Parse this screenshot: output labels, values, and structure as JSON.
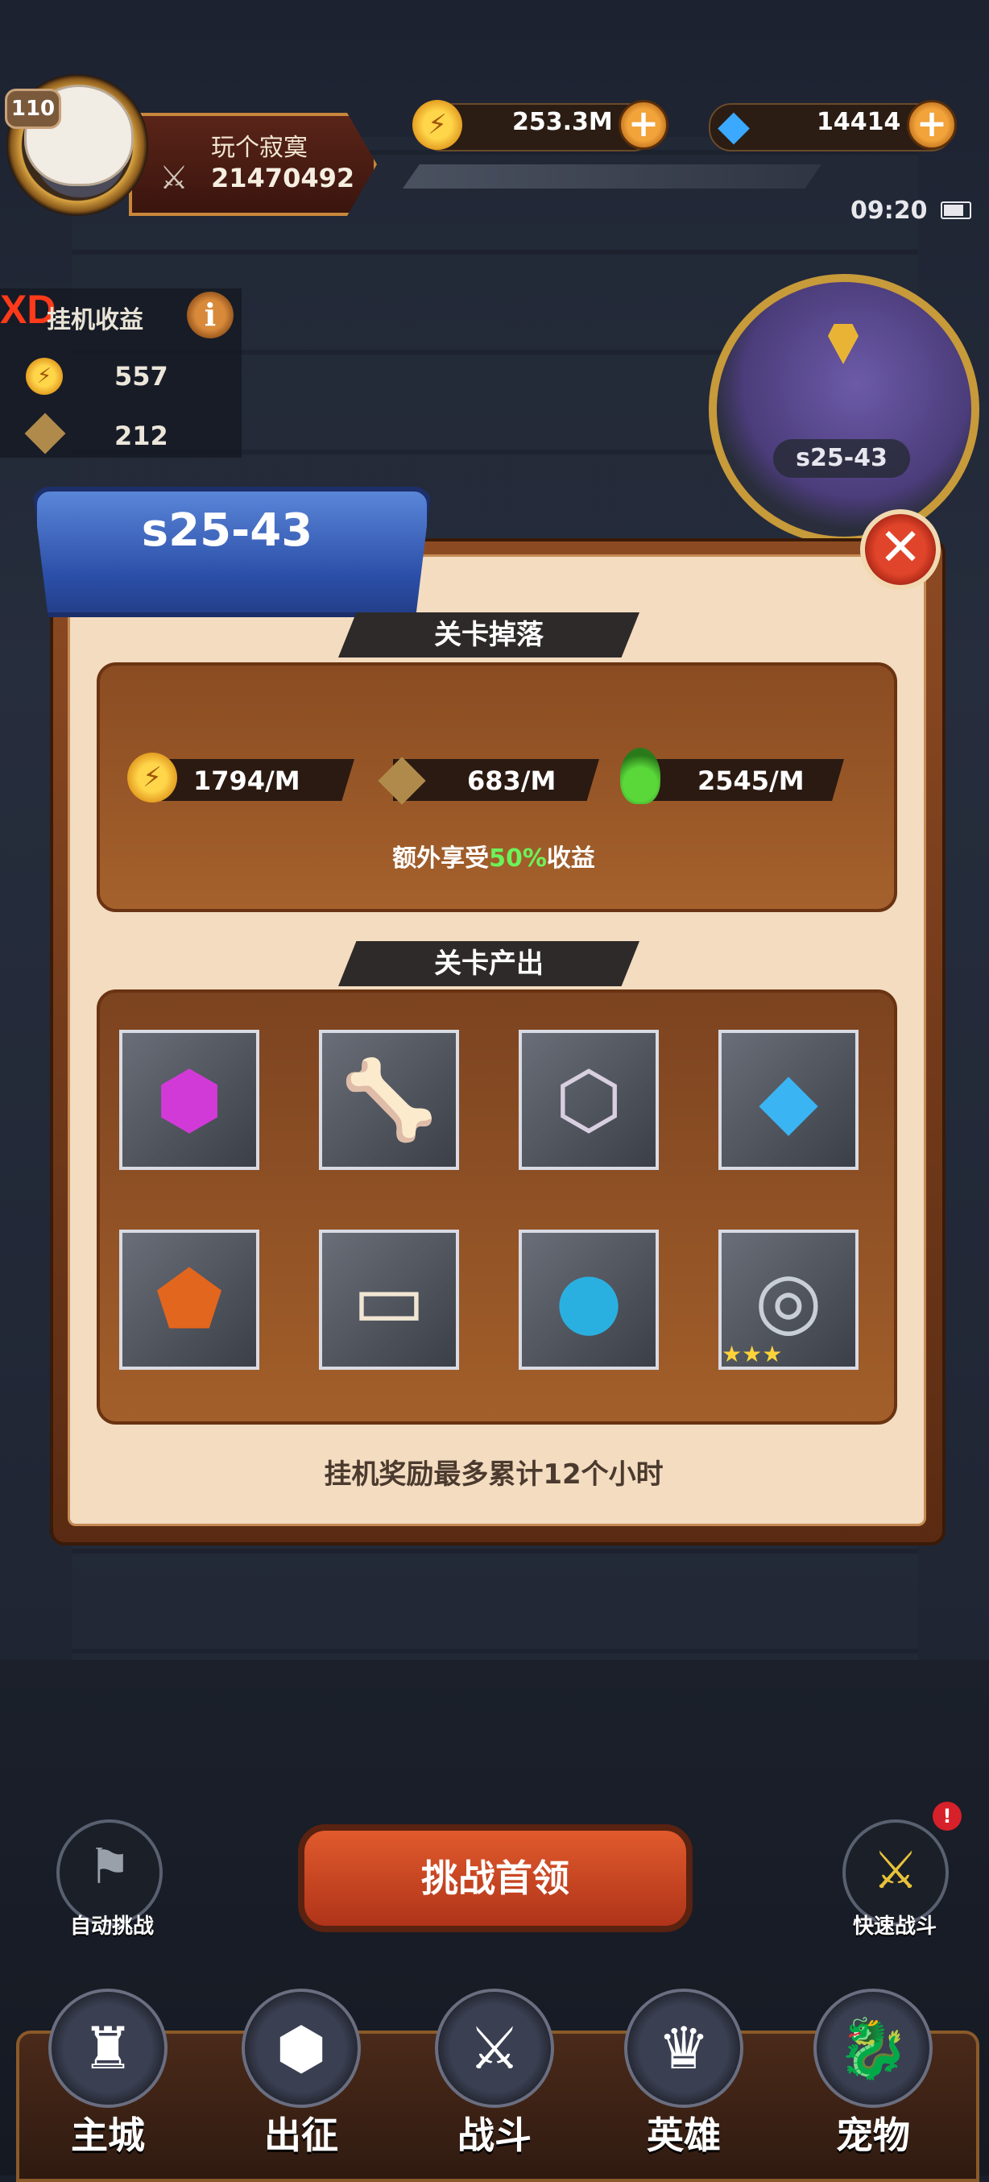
{
  "player": {
    "level": "110",
    "name": "玩个寂寞",
    "power": "21470492"
  },
  "resources": {
    "gold": "253.3M",
    "gems": "14414",
    "add_symbol": "+"
  },
  "status_bar": {
    "time": "09:20"
  },
  "idle_panel": {
    "brand_mark": "XD",
    "title": "挂机收益",
    "info_symbol": "i",
    "gold_value": "557",
    "exp_value": "212"
  },
  "minimap": {
    "stage_label": "s25-43"
  },
  "dialog": {
    "stage_title": "s25-43",
    "close_symbol": "✕",
    "drop_section_title": "关卡掉落",
    "rates": [
      {
        "icon": "gold-coin-icon",
        "value": "1794/M"
      },
      {
        "icon": "exp-icon",
        "value": "683/M"
      },
      {
        "icon": "green-potion-icon",
        "value": "2545/M"
      }
    ],
    "bonus_prefix": "额外享受",
    "bonus_percent": "50%",
    "bonus_suffix": "收益",
    "output_section_title": "关卡产出",
    "items": [
      {
        "name": "purple-gem-item",
        "glyph": "⬢",
        "color": "#d23ad8"
      },
      {
        "name": "bone-treat-item",
        "glyph": "🦴",
        "color": "#e8953a"
      },
      {
        "name": "silver-crystal-item",
        "glyph": "⬡",
        "color": "#d8cfe0"
      },
      {
        "name": "blue-crystals-item",
        "glyph": "◆",
        "color": "#3ab4f2"
      },
      {
        "name": "orange-rune-stone-item",
        "glyph": "⬟",
        "color": "#e2661e"
      },
      {
        "name": "hero-card-item",
        "glyph": "▭",
        "color": "#f1e6d2"
      },
      {
        "name": "blue-orb-item",
        "glyph": "●",
        "color": "#2ab0e0"
      },
      {
        "name": "bracelet-item",
        "glyph": "◎",
        "color": "#c8cfd8",
        "stars": "★★★"
      }
    ],
    "footer_note": "挂机奖励最多累计12个小时"
  },
  "controls": {
    "auto_challenge": "自动挑战",
    "challenge_boss": "挑战首领",
    "quick_battle": "快速战斗",
    "alert_symbol": "!"
  },
  "nav": [
    {
      "label": "主城",
      "icon": "tower-icon",
      "glyph": "♜"
    },
    {
      "label": "出征",
      "icon": "expedition-icon",
      "glyph": "⬢"
    },
    {
      "label": "战斗",
      "icon": "battle-shield-icon",
      "glyph": "⚔"
    },
    {
      "label": "英雄",
      "icon": "hero-crown-icon",
      "glyph": "♛"
    },
    {
      "label": "宠物",
      "icon": "pet-dragon-icon",
      "glyph": "🐉"
    }
  ],
  "colors": {
    "accent_gold": "#d9a441",
    "bonus_green": "#6cf25a",
    "panel_bg": "#f3dcc0",
    "banner_blue": "#2b4fa8"
  }
}
